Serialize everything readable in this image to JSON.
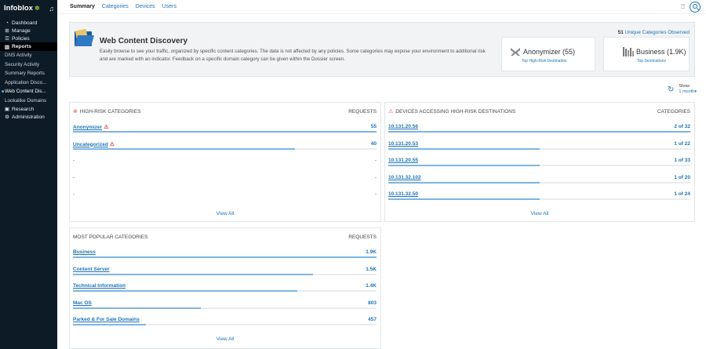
{
  "sidebar": {
    "logo": "Infoblox",
    "items": [
      {
        "label": "Dashboard",
        "icon": "dashboard-icon",
        "glyph": "◔"
      },
      {
        "label": "Manage",
        "icon": "manage-icon",
        "glyph": "⊞"
      },
      {
        "label": "Policies",
        "icon": "policies-icon",
        "glyph": "☰"
      },
      {
        "label": "Reports",
        "icon": "reports-icon",
        "glyph": "▥"
      }
    ],
    "sub_items": [
      "DNS Activity",
      "Security Activity",
      "Summary Reports",
      "Application Disco...",
      "Web Content Dis...",
      "Lookalike Domains"
    ],
    "selected_sub": "Web Content Dis...",
    "bottom_items": [
      {
        "label": "Research",
        "icon": "research-icon",
        "glyph": "▣"
      },
      {
        "label": "Administration",
        "icon": "administration-icon",
        "glyph": "⚙"
      }
    ]
  },
  "tabs": [
    "Summary",
    "Categories",
    "Devices",
    "Users"
  ],
  "banner": {
    "title": "Web Content Discovery",
    "description": "Easily browse to see your traffic, organized by specific content categories. The data is not affected by any policies. Some categories may expose your environment to additional risk and are marked with an indicator. Feedback on a specific domain category can be given within the Dossier screen.",
    "unique_count": "51",
    "unique_label": "Unique Categories Observed",
    "tiles": [
      {
        "main": "Anonymizer (55)",
        "sub": "Top High-Risk Destination",
        "icon": "anonymizer-icon"
      },
      {
        "main": "Business (1.9K)",
        "sub": "Top Destinations",
        "icon": "business-icon"
      }
    ]
  },
  "show": {
    "label": "Show",
    "value": "1 month"
  },
  "high_risk": {
    "title": "HIGH-RISK CATEGORIES",
    "col": "REQUESTS",
    "rows": [
      {
        "label": "Anonymizer",
        "value": "55",
        "fraction": 1.0
      },
      {
        "label": "Uncategorized",
        "value": "40",
        "fraction": 0.73
      },
      {
        "label": "-",
        "value": "-",
        "fraction": 0
      },
      {
        "label": "-",
        "value": "-",
        "fraction": 0
      },
      {
        "label": "-",
        "value": "-",
        "fraction": 0
      }
    ],
    "view_all": "View All"
  },
  "devices": {
    "title": "DEVICES ACCESSING HIGH-RISK DESTINATIONS",
    "col": "CATEGORIES",
    "rows": [
      {
        "label": "10.131.20.56",
        "value": "2 of 32",
        "fraction": 1.0
      },
      {
        "label": "10.131.20.53",
        "value": "1 of 22",
        "fraction": 0.5
      },
      {
        "label": "10.131.20.55",
        "value": "1 of 33",
        "fraction": 0.5
      },
      {
        "label": "10.131.32.102",
        "value": "1 of 20",
        "fraction": 0.5
      },
      {
        "label": "10.131.32.50",
        "value": "1 of 24",
        "fraction": 0.5
      }
    ],
    "view_all": "View All"
  },
  "popular": {
    "title": "MOST POPULAR CATEGORIES",
    "col": "REQUESTS",
    "rows": [
      {
        "label": "Business",
        "value": "1.9K",
        "fraction": 1.0
      },
      {
        "label": "Content Server",
        "value": "1.5K",
        "fraction": 0.79
      },
      {
        "label": "Technical Information",
        "value": "1.4K",
        "fraction": 0.74
      },
      {
        "label": "Mac OS",
        "value": "803",
        "fraction": 0.42
      },
      {
        "label": "Parked & For Sale Domains",
        "value": "457",
        "fraction": 0.24
      }
    ],
    "view_all": "View All"
  },
  "colors": {
    "accent": "#1f74b6",
    "bar": "#7fb5df",
    "sidebar": "#0d1b27",
    "warning": "#d9534f"
  }
}
